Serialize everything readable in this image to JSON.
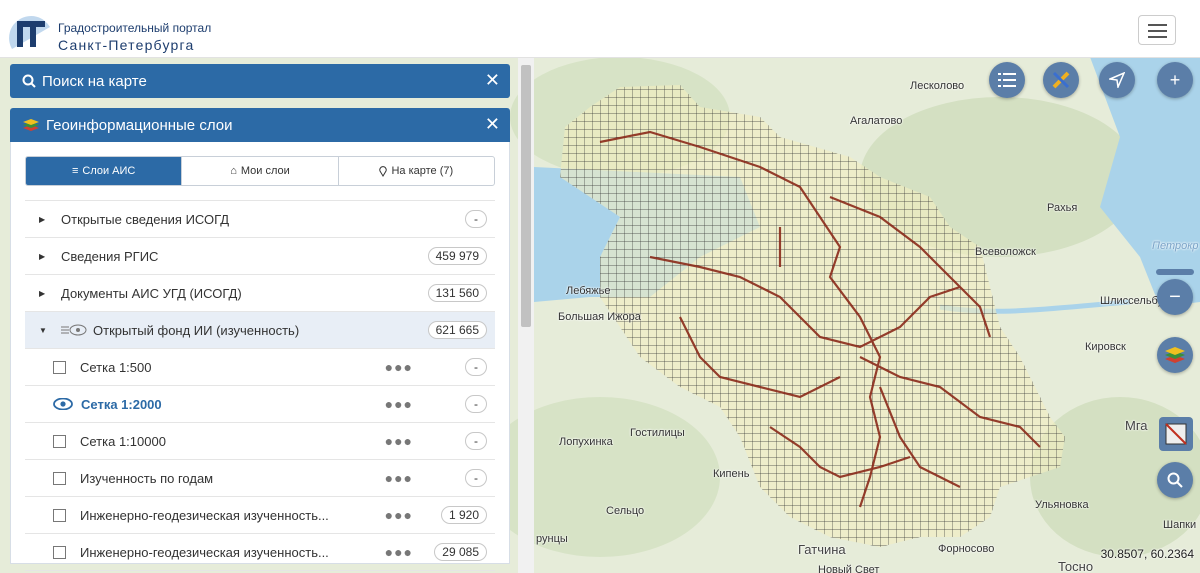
{
  "header": {
    "brand_line1": "Градостроительный портал",
    "brand_line2": "Санкт-Петербурга"
  },
  "search_panel": {
    "title": "Поиск на карте"
  },
  "layers_panel": {
    "title": "Геоинформационные слои",
    "tabs": [
      {
        "label": "Слои АИС",
        "icon": "list-icon"
      },
      {
        "label": "Мои слои",
        "icon": "home-icon"
      },
      {
        "label": "На карте (7)",
        "icon": "map-pin-icon"
      }
    ],
    "rows": [
      {
        "label": "Открытые сведения ИСОГД",
        "count": "-"
      },
      {
        "label": "Сведения РГИС",
        "count": "459 979"
      },
      {
        "label": "Документы АИС УГД (ИСОГД)",
        "count": "131 560"
      },
      {
        "label": "Открытый фонд ИИ (изученность)",
        "count": "621 665"
      }
    ],
    "sub_rows": [
      {
        "label": "Сетка 1:500",
        "count": "-"
      },
      {
        "label": "Сетка 1:2000",
        "count": "-"
      },
      {
        "label": "Сетка 1:10000",
        "count": "-"
      },
      {
        "label": "Изученность по годам",
        "count": "-"
      },
      {
        "label": "Инженерно-геодезическая изученность...",
        "count": "1 920"
      },
      {
        "label": "Инженерно-геодезическая изученность...",
        "count": "29 085"
      }
    ]
  },
  "map": {
    "labels": {
      "leskolovo": "Лесколово",
      "agalatovo": "Агалатово",
      "rakhya": "Рахья",
      "vsevolozhsk": "Всеволожск",
      "petrokrepost": "Петрокр",
      "shlisselburg": "Шлиссельбург",
      "kirovsk": "Кировск",
      "lebyazhye": "Лебяжье",
      "bolshaya_izhora": "Большая Ижора",
      "lopukhinka": "Лопухинка",
      "gostilitsy": "Гостилицы",
      "kipen": "Кипень",
      "selco": "Сельцо",
      "gatchina": "Гатчина",
      "fornosovo": "Форносово",
      "ulyanovka": "Ульяновка",
      "mga": "Мга",
      "shapki": "Шапки",
      "tosno": "Тосно",
      "novy_svet": "Новый Свет",
      "runitsy": "рунцы"
    },
    "coordinates": "30.8507, 60.2364",
    "controls": [
      "legend-icon",
      "measure-icon",
      "locate-icon",
      "zoom-in-icon",
      "zoom-out-icon",
      "layers-icon",
      "extent-icon",
      "search-icon"
    ]
  },
  "colors": {
    "brand": "#2c6aa6",
    "map_button": "#5b7ea8",
    "boundary": "#8b2a1a"
  }
}
